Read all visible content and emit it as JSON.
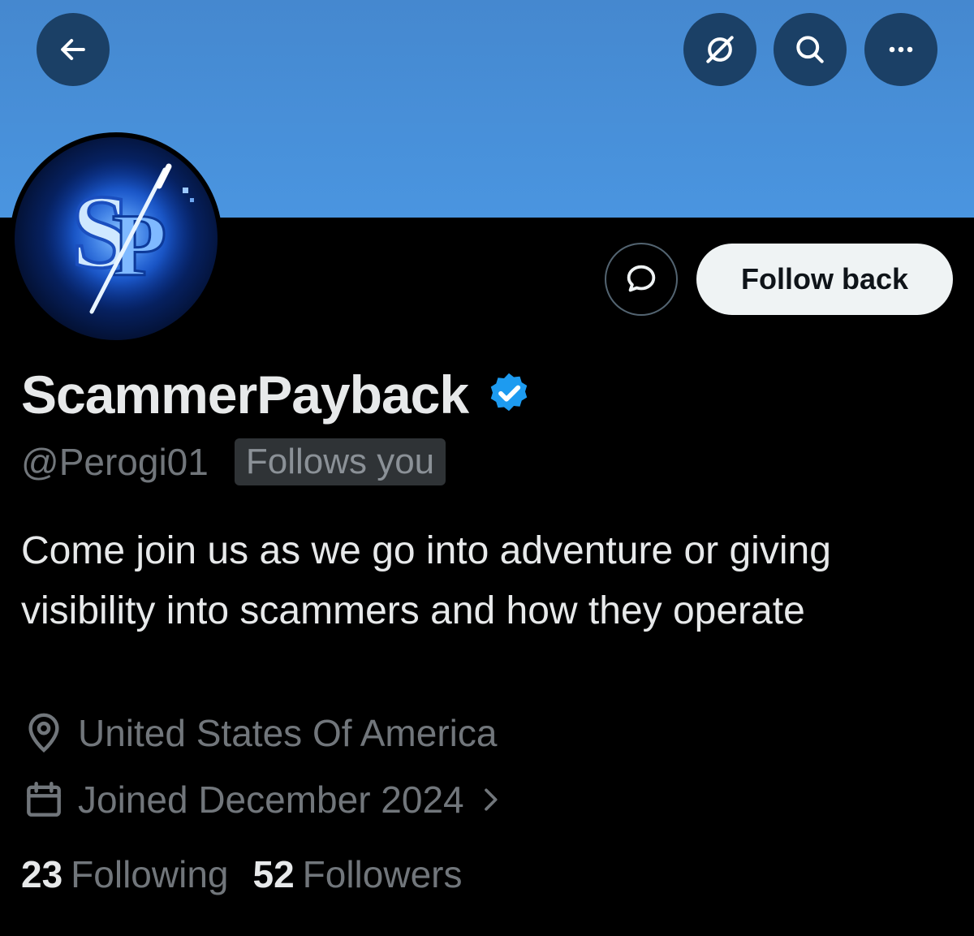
{
  "header": {
    "back_icon": "arrow-left-icon",
    "grok_icon": "grok-icon",
    "search_icon": "search-icon",
    "more_icon": "more-icon",
    "banner_color": "#4a95e0"
  },
  "profile": {
    "display_name": "ScammerPayback",
    "verified_icon": "verified-badge-icon",
    "verified_color": "#1d9bf0",
    "handle": "@Perogi01",
    "follows_you": "Follows you",
    "bio": "Come join us as we go into adventure or giving visibility into scammers and how they operate",
    "location": "United States Of America",
    "joined": "Joined December 2024",
    "following_count": "23",
    "following_label": "Following",
    "followers_count": "52",
    "followers_label": "Followers"
  },
  "actions": {
    "message_icon": "message-bubble-icon",
    "follow_back_label": "Follow back"
  }
}
